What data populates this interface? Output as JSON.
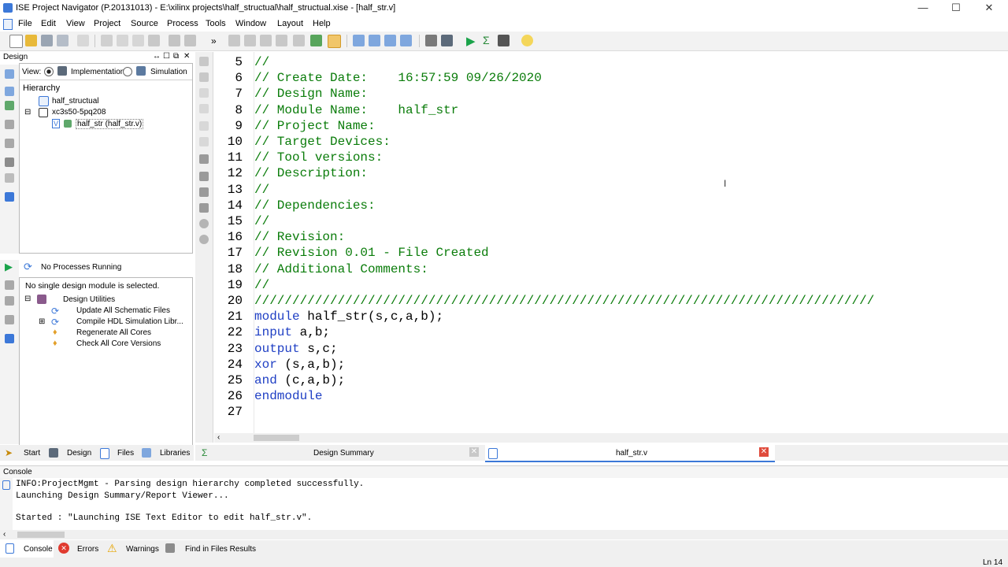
{
  "window": {
    "title": "ISE Project Navigator (P.20131013) - E:\\xilinx projects\\half_structual\\half_structual.xise - [half_str.v]",
    "minimize": "—",
    "maximize": "☐",
    "close": "✕"
  },
  "menu": [
    "File",
    "Edit",
    "View",
    "Project",
    "Source",
    "Process",
    "Tools",
    "Window",
    "Layout",
    "Help"
  ],
  "design_panel": {
    "title": "Design",
    "view_label": "View:",
    "implementation": "Implementation",
    "simulation": "Simulation",
    "hierarchy_label": "Hierarchy",
    "tree": {
      "project": "half_structual",
      "device": "xc3s50-5pq208",
      "module": "half_str (half_str.v)"
    }
  },
  "processes_panel": {
    "status": "No Processes Running",
    "message": "No single design module is selected.",
    "group": "Design Utilities",
    "items": [
      "Update All Schematic Files",
      "Compile HDL Simulation Libr...",
      "Regenerate All Cores",
      "Check All Core Versions"
    ]
  },
  "left_tabs": [
    "Start",
    "Design",
    "Files",
    "Libraries"
  ],
  "doc_tabs": [
    "Design Summary",
    "half_str.v"
  ],
  "editor": {
    "lines": [
      {
        "n": "5",
        "text": "//",
        "kind": "comment"
      },
      {
        "n": "6",
        "text": "// Create Date:    16:57:59 09/26/2020",
        "kind": "comment"
      },
      {
        "n": "7",
        "text": "// Design Name:",
        "kind": "comment"
      },
      {
        "n": "8",
        "text": "// Module Name:    half_str",
        "kind": "comment"
      },
      {
        "n": "9",
        "text": "// Project Name:",
        "kind": "comment"
      },
      {
        "n": "10",
        "text": "// Target Devices:",
        "kind": "comment"
      },
      {
        "n": "11",
        "text": "// Tool versions:",
        "kind": "comment"
      },
      {
        "n": "12",
        "text": "// Description:",
        "kind": "comment"
      },
      {
        "n": "13",
        "text": "//",
        "kind": "comment"
      },
      {
        "n": "14",
        "text": "// Dependencies:",
        "kind": "comment"
      },
      {
        "n": "15",
        "text": "//",
        "kind": "comment"
      },
      {
        "n": "16",
        "text": "// Revision:",
        "kind": "comment"
      },
      {
        "n": "17",
        "text": "// Revision 0.01 - File Created",
        "kind": "comment"
      },
      {
        "n": "18",
        "text": "// Additional Comments:",
        "kind": "comment"
      },
      {
        "n": "19",
        "text": "//",
        "kind": "comment"
      },
      {
        "n": "20",
        "text": "//////////////////////////////////////////////////////////////////////////////////",
        "kind": "comment"
      },
      {
        "n": "21",
        "kw": "module",
        "rest": " half_str(s,c,a,b);",
        "kind": "code"
      },
      {
        "n": "22",
        "kw": "input",
        "rest": " a,b;",
        "kind": "code"
      },
      {
        "n": "23",
        "kw": "output",
        "rest": " s,c;",
        "kind": "code"
      },
      {
        "n": "24",
        "kw": "xor",
        "rest": " (s,a,b);",
        "kind": "code"
      },
      {
        "n": "25",
        "kw": "and",
        "rest": " (c,a,b);",
        "kind": "code"
      },
      {
        "n": "26",
        "kw": "endmodule",
        "rest": "",
        "kind": "code"
      },
      {
        "n": "27",
        "text": "",
        "kind": "code"
      }
    ]
  },
  "console": {
    "title": "Console",
    "lines": [
      "INFO:ProjectMgmt - Parsing design hierarchy completed successfully.",
      "Launching Design Summary/Report Viewer...",
      "",
      "Started : \"Launching ISE Text Editor to edit half_str.v\"."
    ]
  },
  "bottom_tabs": [
    "Console",
    "Errors",
    "Warnings",
    "Find in Files Results"
  ],
  "status": {
    "position": "Ln 14"
  },
  "colors": {
    "comment": "#0a7c0a",
    "keyword": "#1f3fc4",
    "accent": "#3c78d8"
  }
}
